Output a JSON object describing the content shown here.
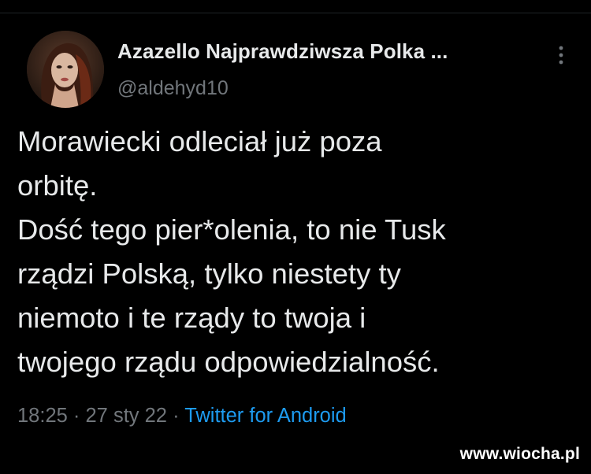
{
  "tweet": {
    "author": {
      "display_name": "Azazello Najprawdziwsza Polka ...",
      "handle": "@aldehyd10"
    },
    "menu_icon": "more-vertical-icon",
    "text_lines": [
      "Morawiecki odleciał już poza",
      "orbitę.",
      "Dość tego pier*olenia, to nie Tusk",
      "rządzi Polską, tylko niestety ty",
      "niemoto i te rządy to twoja i",
      "twojego rządu odpowiedzialność."
    ],
    "time": "18:25",
    "separator": "·",
    "date": "27 sty 22",
    "source": "Twitter for Android"
  },
  "watermark": "www.wiocha.pl",
  "colors": {
    "background": "#000000",
    "text": "#e7e9ea",
    "secondary": "#71767b",
    "link": "#1d9bf0"
  }
}
